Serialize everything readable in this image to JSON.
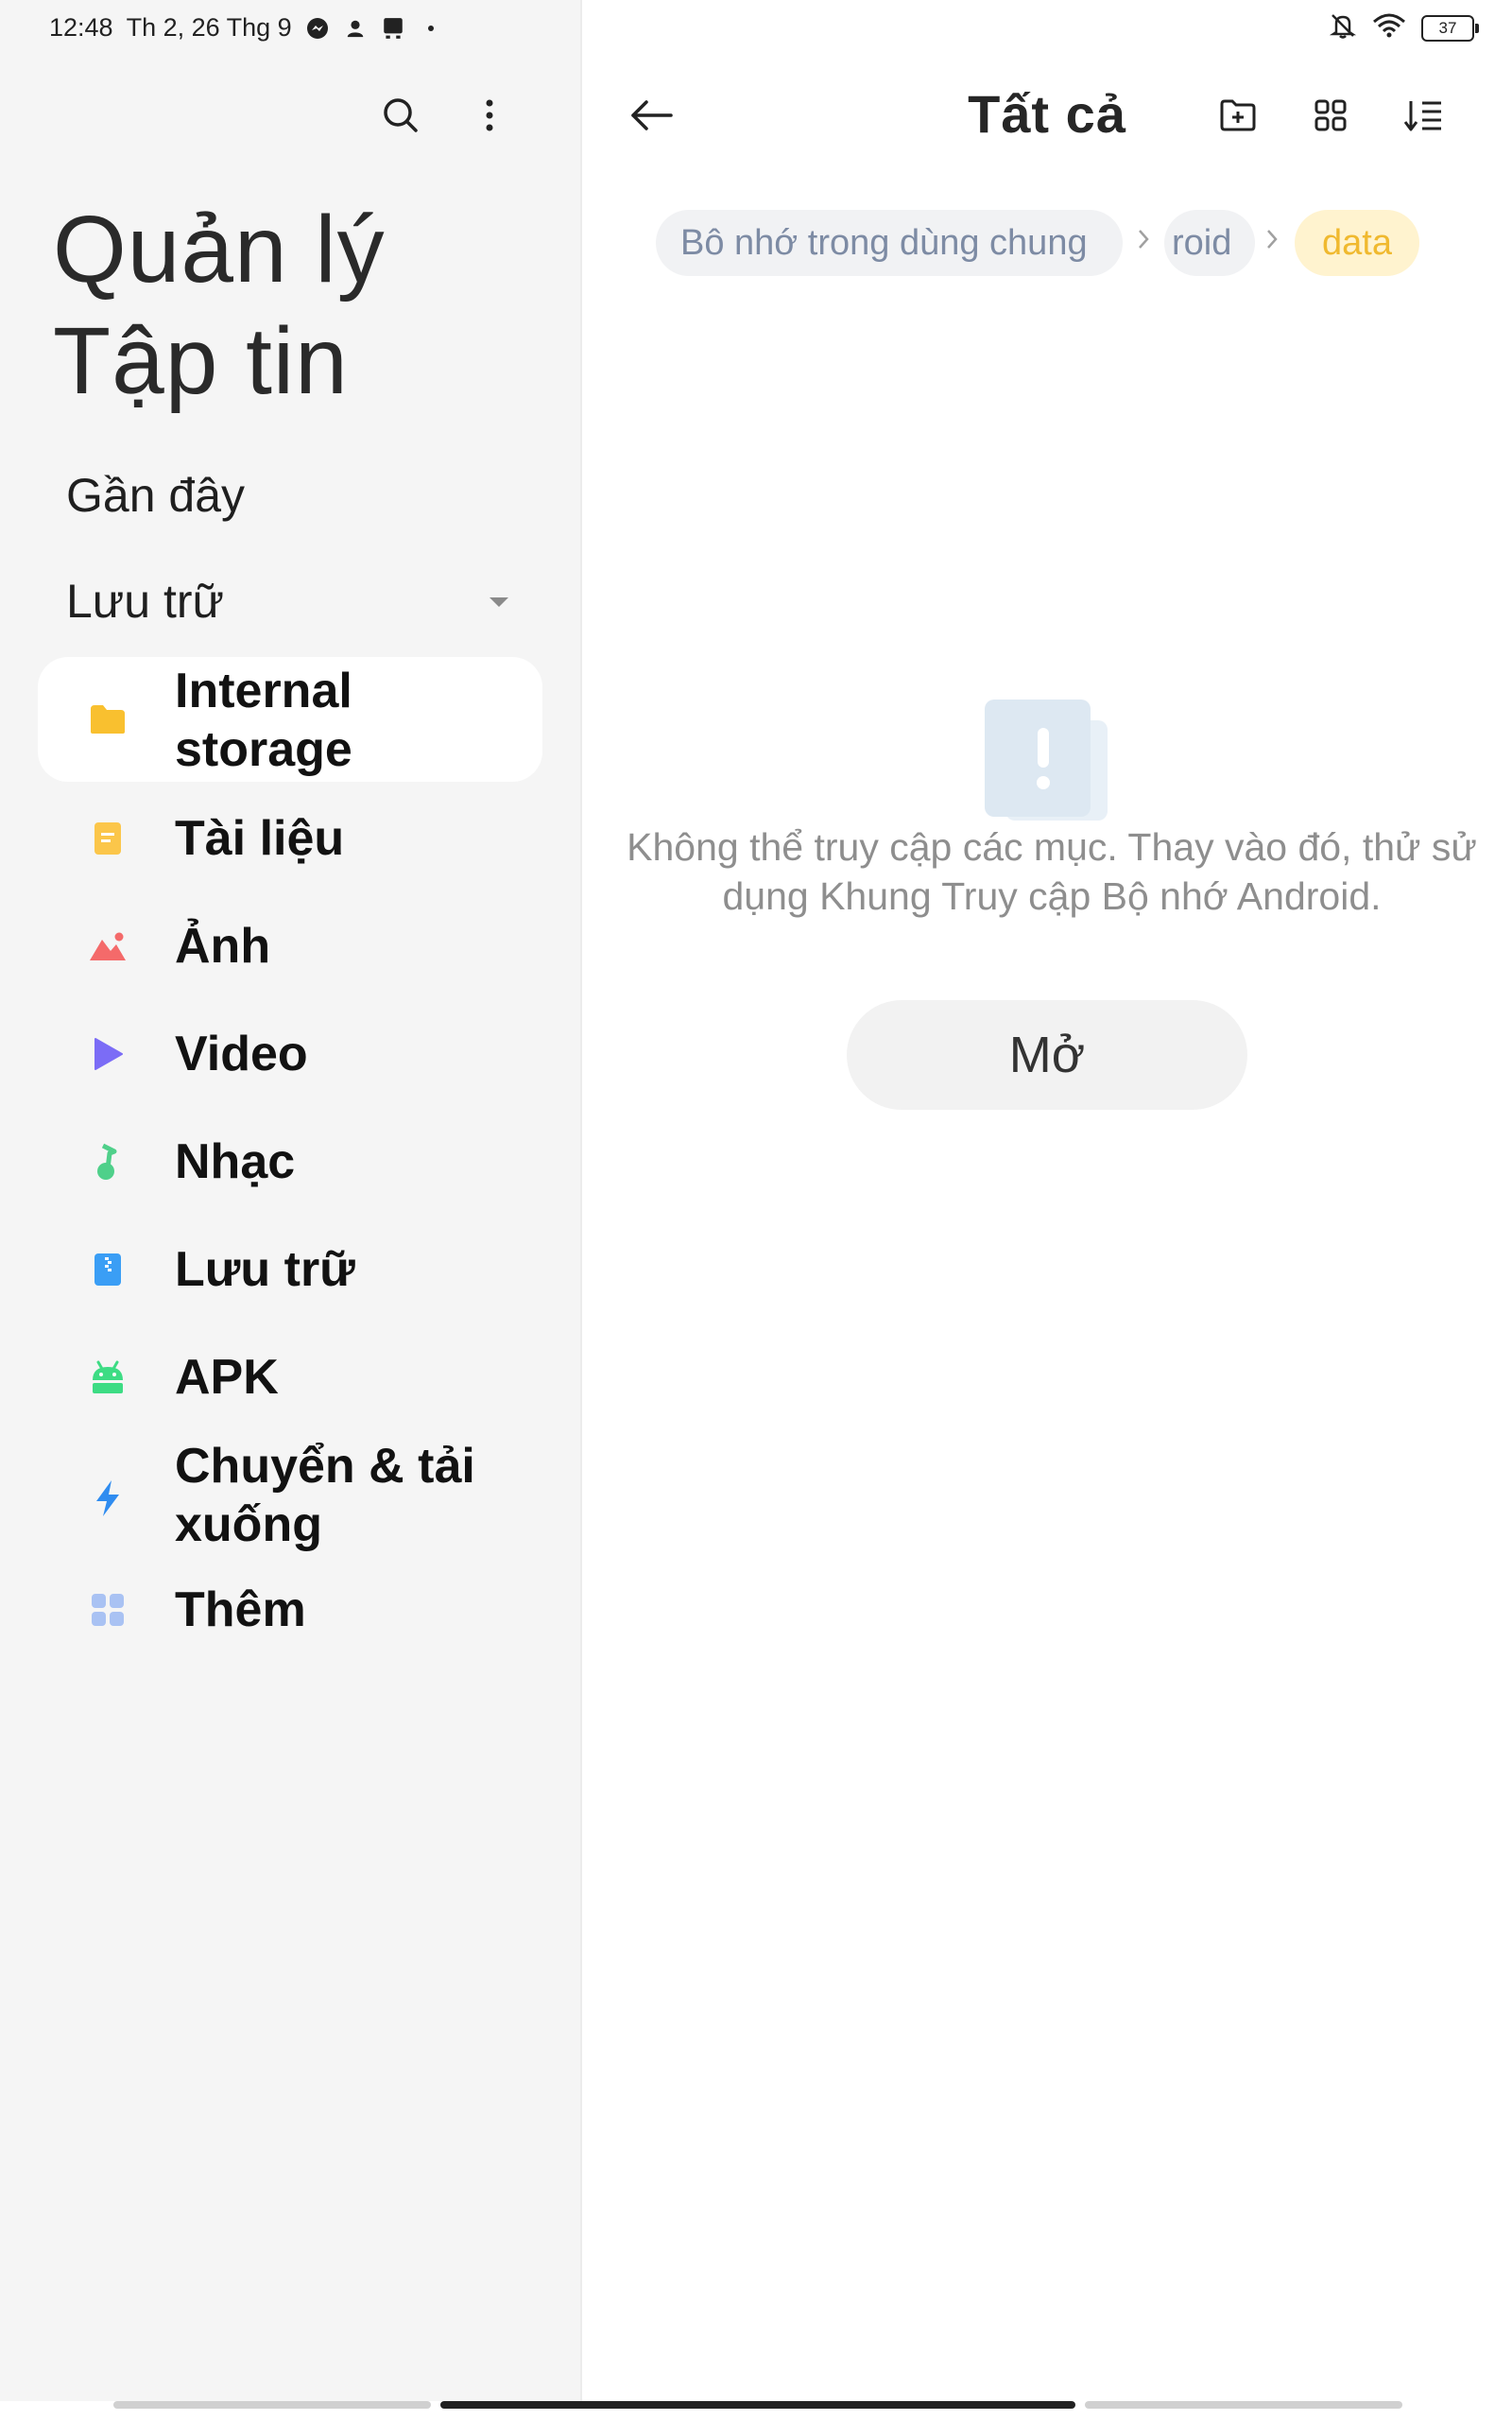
{
  "status_bar": {
    "time": "12:48",
    "date": "Th 2, 26 Thg 9",
    "battery": "37",
    "left_icons": [
      "messenger-icon",
      "person-icon",
      "download-box-icon",
      "dot-icon"
    ],
    "right_icons": [
      "muted-bell-icon",
      "wifi-icon",
      "battery-icon"
    ]
  },
  "sidebar": {
    "app_title_line1": "Quản lý",
    "app_title_line2": "Tập tin",
    "recent_label": "Gần đây",
    "storage_label": "Lưu trữ",
    "items": [
      {
        "label": "Internal storage",
        "icon": "folder-icon",
        "color": "#f7c542",
        "active": true
      },
      {
        "label": "Tài liệu",
        "icon": "document-icon",
        "color": "#f9c54a"
      },
      {
        "label": "Ảnh",
        "icon": "image-icon",
        "color": "#f46a6a"
      },
      {
        "label": "Video",
        "icon": "play-icon",
        "color": "#7b6cf6"
      },
      {
        "label": "Nhạc",
        "icon": "music-icon",
        "color": "#4fd08a"
      },
      {
        "label": "Lưu trữ",
        "icon": "archive-icon",
        "color": "#3a9ef5"
      },
      {
        "label": "APK",
        "icon": "android-icon",
        "color": "#3ddc84"
      },
      {
        "label": "Chuyển & tải xuống",
        "icon": "transfer-icon",
        "color": "#2f8cf0"
      },
      {
        "label": "Thêm",
        "icon": "more-apps-icon",
        "color": "#a9c2f3"
      }
    ]
  },
  "main": {
    "title": "Tất cả",
    "breadcrumbs": [
      "Bô nhớ trong dùng chung",
      "roid",
      "data"
    ],
    "message_line1": "Không thể truy cập các mục. Thay vào đó, thử sử",
    "message_line2": "dụng Khung Truy cập Bộ nhớ Android.",
    "open_button": "Mở"
  }
}
